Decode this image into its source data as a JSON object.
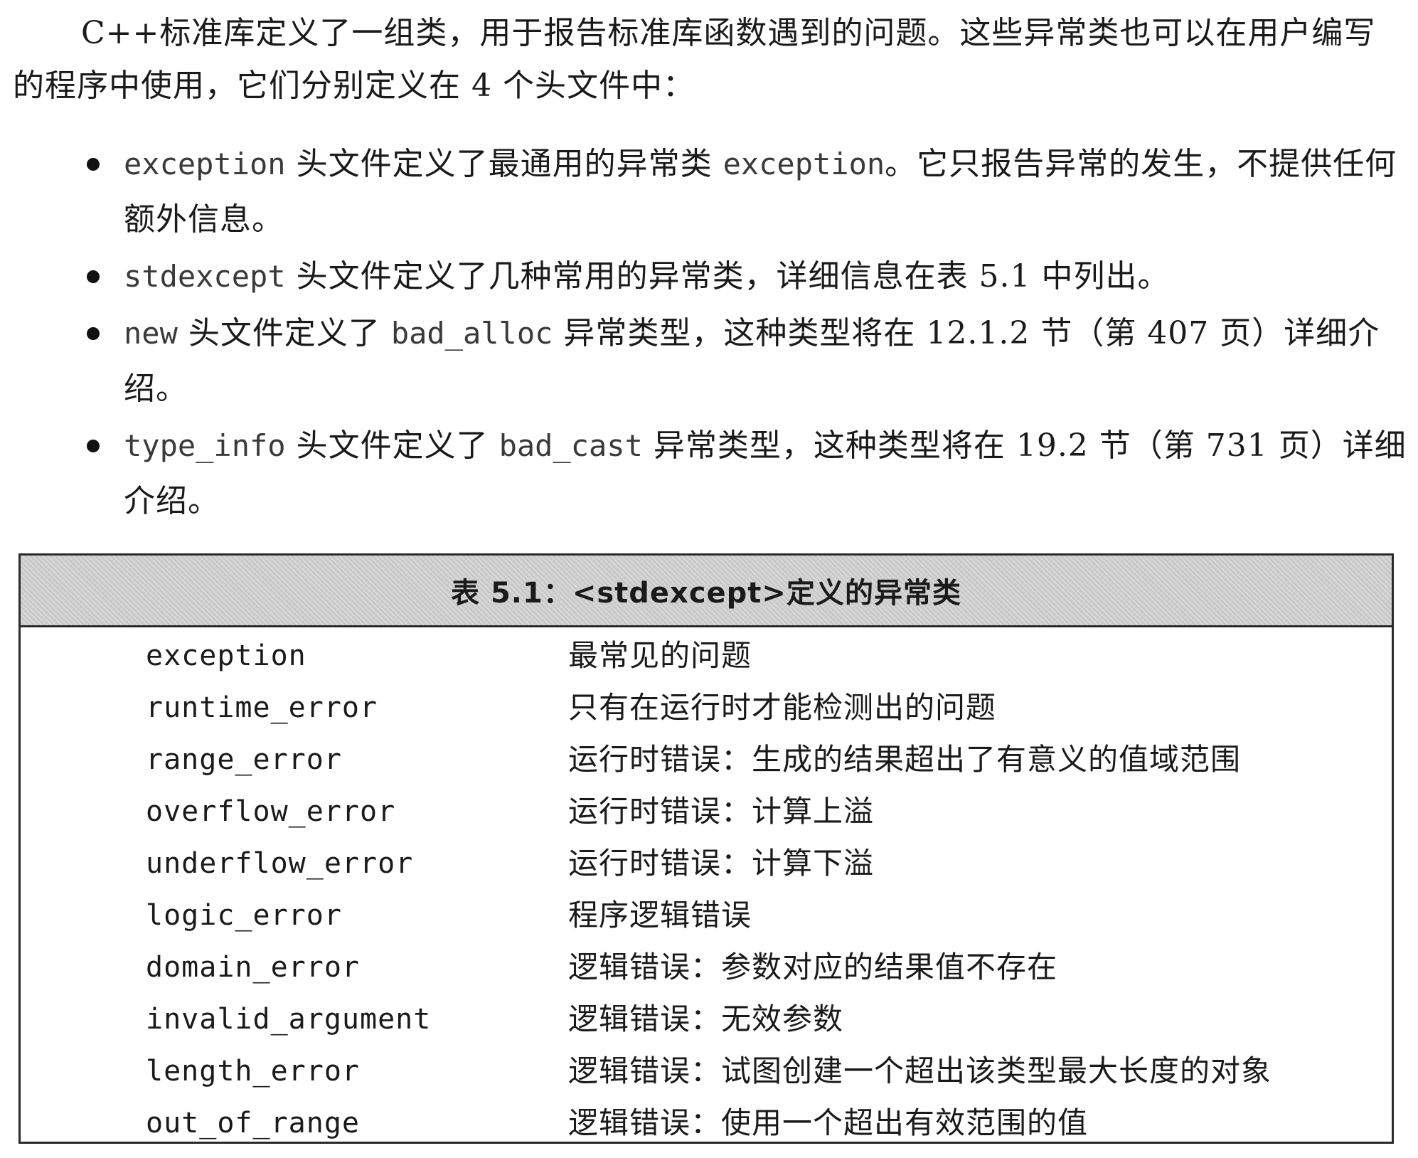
{
  "intro": {
    "text": "C++标准库定义了一组类，用于报告标准库函数遇到的问题。这些异常类也可以在用户编写的程序中使用，它们分别定义在 4 个头文件中："
  },
  "bullets": [
    {
      "code": "exception",
      "text1": " 头文件定义了最通用的异常类 ",
      "code2": "exception",
      "text2": "。它只报告异常的发生，不提供任何额外信息。"
    },
    {
      "code": "stdexcept",
      "text1": " 头文件定义了几种常用的异常类，详细信息在表 5.1 中列出。",
      "code2": "",
      "text2": ""
    },
    {
      "code": "new",
      "text1": " 头文件定义了 ",
      "code2": "bad_alloc",
      "text2": " 异常类型，这种类型将在 12.1.2 节（第 407 页）详细介绍。"
    },
    {
      "code": "type_info",
      "text1": " 头文件定义了 ",
      "code2": "bad_cast",
      "text2": " 异常类型，这种类型将在 19.2 节（第 731 页）详细介绍。"
    }
  ],
  "table": {
    "caption": "表 5.1：<stdexcept>定义的异常类",
    "rows": [
      {
        "name": "exception",
        "desc": "最常见的问题"
      },
      {
        "name": "runtime_error",
        "desc": "只有在运行时才能检测出的问题"
      },
      {
        "name": "range_error",
        "desc": "运行时错误：生成的结果超出了有意义的值域范围"
      },
      {
        "name": "overflow_error",
        "desc": "运行时错误：计算上溢"
      },
      {
        "name": "underflow_error",
        "desc": "运行时错误：计算下溢"
      },
      {
        "name": "logic_error",
        "desc": "程序逻辑错误"
      },
      {
        "name": "domain_error",
        "desc": "逻辑错误：参数对应的结果值不存在"
      },
      {
        "name": "invalid_argument",
        "desc": "逻辑错误：无效参数"
      },
      {
        "name": "length_error",
        "desc": "逻辑错误：试图创建一个超出该类型最大长度的对象"
      },
      {
        "name": "out_of_range",
        "desc": "逻辑错误：使用一个超出有效范围的值"
      }
    ]
  }
}
